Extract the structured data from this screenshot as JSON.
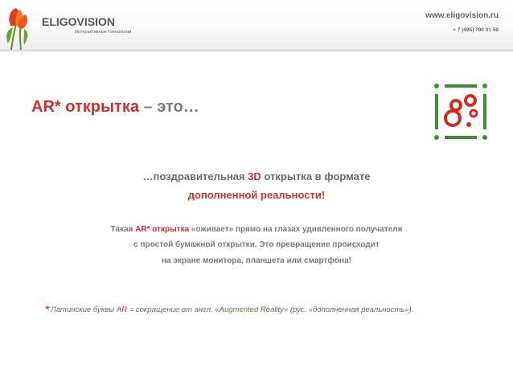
{
  "header": {
    "logo_text": "ELIGOVISION",
    "logo_subtitle": "Интерактивные Технологии",
    "website": "www.eligovision.ru",
    "phone": "+ 7 (495) 780 01 59"
  },
  "title": {
    "part1": "AR* открытка",
    "part2": " – это…"
  },
  "lead": {
    "l1_a": "…поздравительная ",
    "l1_3d": "3D",
    "l1_b": " открытка в формате",
    "line2": "дополненной реальности!"
  },
  "body": {
    "l1_a": "Такая ",
    "l1_red": "AR* открытка",
    "l1_b": " «оживает» прямо на глазах удивленного получателя",
    "line2": "с простой бумажной открытки. Это превращение происходит",
    "line3": "на экране монитора, планшета или смартфона!"
  },
  "footnote": {
    "star": "*",
    "a": "Латинские буквы ",
    "ar": "AR",
    "b": " = сокращение от англ. «",
    "A": "A",
    "c": "ugmented ",
    "R": "R",
    "d": "eality» (рус. «дополненная реальность»)."
  },
  "colors": {
    "accent_red": "#c8312c",
    "accent_green": "#4b8b3b",
    "text_gray": "#7a7a7a"
  }
}
